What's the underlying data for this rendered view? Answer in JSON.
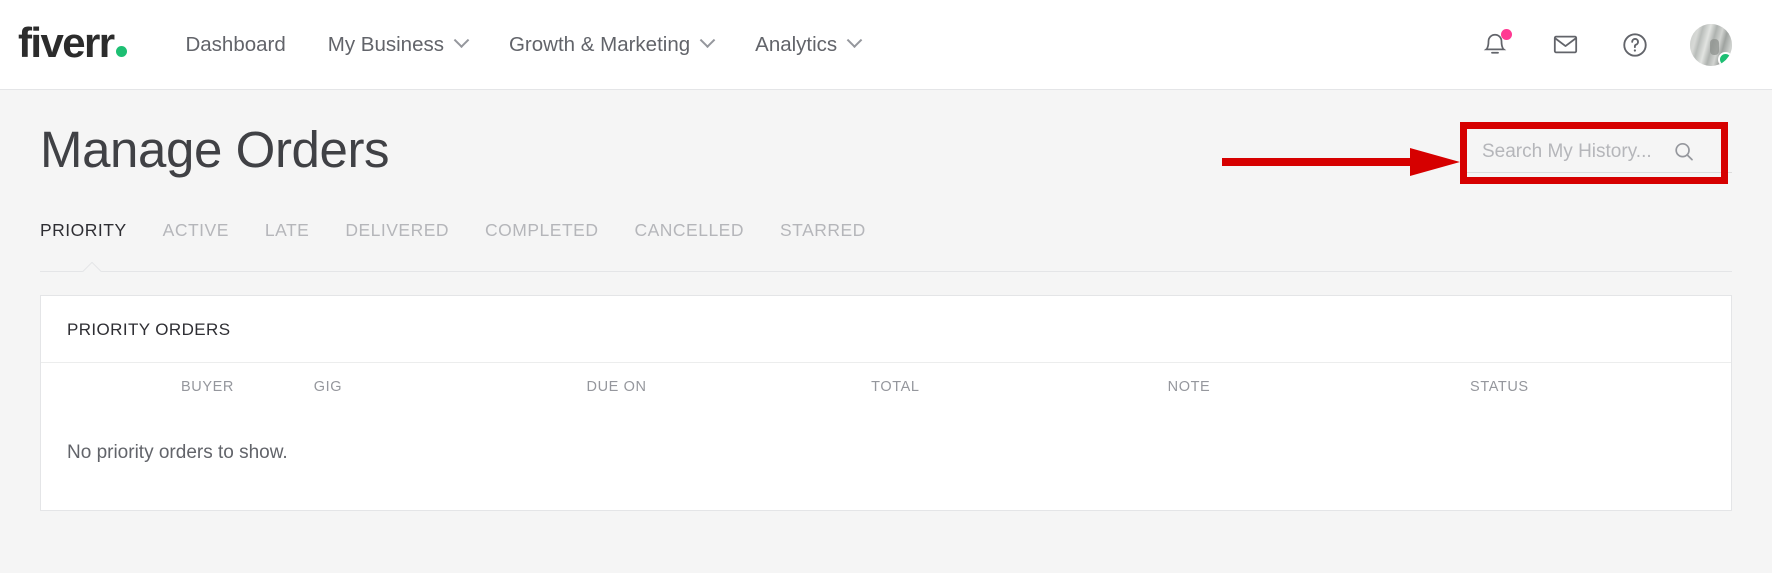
{
  "header": {
    "logo_text": "fiverr",
    "logo_dot_color": "#1dbf73",
    "nav": [
      {
        "label": "Dashboard",
        "has_chevron": false
      },
      {
        "label": "My Business",
        "has_chevron": true
      },
      {
        "label": "Growth & Marketing",
        "has_chevron": true
      },
      {
        "label": "Analytics",
        "has_chevron": true
      }
    ],
    "icons": {
      "notifications": "bell-icon",
      "notifications_badge_color": "#ff3992",
      "messages": "envelope-icon",
      "help": "question-circle-icon",
      "avatar": "user-avatar",
      "avatar_status_color": "#1dbf73"
    }
  },
  "page": {
    "title": "Manage Orders"
  },
  "search": {
    "value": "",
    "placeholder": "Search My History...",
    "icon": "search-icon"
  },
  "annotation": {
    "color": "#d60000",
    "shape": "arrow-and-box",
    "target": "search-input"
  },
  "tabs": [
    {
      "label": "PRIORITY",
      "active": true
    },
    {
      "label": "ACTIVE",
      "active": false
    },
    {
      "label": "LATE",
      "active": false
    },
    {
      "label": "DELIVERED",
      "active": false
    },
    {
      "label": "COMPLETED",
      "active": false
    },
    {
      "label": "CANCELLED",
      "active": false
    },
    {
      "label": "STARRED",
      "active": false
    }
  ],
  "card": {
    "heading": "PRIORITY ORDERS",
    "columns": [
      "BUYER",
      "GIG",
      "DUE ON",
      "TOTAL",
      "NOTE",
      "STATUS"
    ],
    "rows": [],
    "empty_message": "No priority orders to show."
  }
}
